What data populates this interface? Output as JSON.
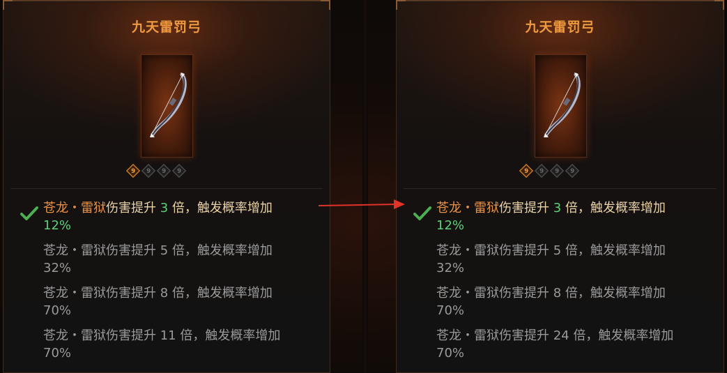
{
  "panels": [
    {
      "title": "九天雷罚弓",
      "sockets": [
        "9",
        "9",
        "9",
        "9"
      ],
      "affixes": [
        {
          "name": "苍龙・雷狱",
          "mid": "伤害提升 ",
          "num": "3",
          "tail": " 倍，触发概率增加",
          "pct": "12%",
          "active": true
        },
        {
          "name": "苍龙・雷狱",
          "mid": "伤害提升 ",
          "num": "5",
          "tail": " 倍，触发概率增加",
          "pct": "32%",
          "active": false
        },
        {
          "name": "苍龙・雷狱",
          "mid": "伤害提升 ",
          "num": "8",
          "tail": " 倍，触发概率增加",
          "pct": "70%",
          "active": false
        },
        {
          "name": "苍龙・雷狱",
          "mid": "伤害提升 ",
          "num": "11",
          "tail": " 倍，触发概率增加",
          "pct": "70%",
          "active": false
        }
      ]
    },
    {
      "title": "九天雷罚弓",
      "sockets": [
        "9",
        "9",
        "9",
        "9"
      ],
      "affixes": [
        {
          "name": "苍龙・雷狱",
          "mid": "伤害提升 ",
          "num": "3",
          "tail": " 倍，触发概率增加",
          "pct": "12%",
          "active": true
        },
        {
          "name": "苍龙・雷狱",
          "mid": "伤害提升 ",
          "num": "5",
          "tail": " 倍，触发概率增加",
          "pct": "32%",
          "active": false
        },
        {
          "name": "苍龙・雷狱",
          "mid": "伤害提升 ",
          "num": "8",
          "tail": " 倍，触发概率增加",
          "pct": "70%",
          "active": false
        },
        {
          "name": "苍龙・雷狱",
          "mid": "伤害提升 ",
          "num": "24",
          "tail": " 倍，触发概率增加",
          "pct": "70%",
          "active": false
        }
      ]
    }
  ],
  "colors": {
    "title": "#ef9a3e",
    "active_name": "#e8934a",
    "active_number": "#5fd07a",
    "inactive": "#9a9a9a",
    "arrow": "#e0332a",
    "check": "#4caf50"
  },
  "icons": {
    "weapon": "bow-icon",
    "selected": "checkmark-icon",
    "compare": "red-arrow-icon"
  }
}
